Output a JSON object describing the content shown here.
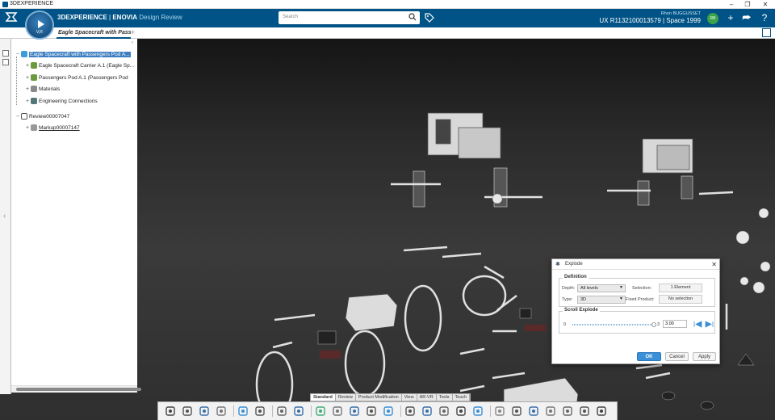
{
  "os": {
    "title": "3DEXPERIENCE",
    "controls": [
      "–",
      "❐",
      "✕"
    ]
  },
  "header": {
    "brand_prefix": "3DEXPERIENCE",
    "brand_app": "ENOVIA",
    "brand_module": "Design Review",
    "search_placeholder": "Search",
    "user_name": "Rhon BUGGUSSET",
    "space": "UX R1132100013579 | Space 1999",
    "avatar_initials": "RB",
    "colors": {
      "header_bg": "#005386",
      "accent": "#3a8fd6",
      "avatar": "#3aa24a"
    }
  },
  "compass": {
    "label": "V,R"
  },
  "tabs": {
    "doc_title": "Eagle Spacecraft with Pass",
    "add": "+"
  },
  "tree": {
    "nodes": [
      {
        "label": "Eagle Spacecraft with Passengers Pod A...",
        "selected": true,
        "icon": "product-icon"
      },
      {
        "label": "Eagle Spacecraft Carrier A.1 (Eagle Sp...",
        "icon": "part-icon"
      },
      {
        "label": "Passengers Pod A.1 (Passengers Pod",
        "icon": "part-icon"
      },
      {
        "label": "Materials",
        "icon": "materials-icon"
      },
      {
        "label": "Engineering Connections",
        "icon": "connections-icon"
      },
      {
        "label": "Review00007047",
        "icon": "review-icon"
      },
      {
        "label": "Markup00007147",
        "icon": "markup-icon"
      }
    ]
  },
  "dialog": {
    "title": "Explode",
    "definition_label": "Definition",
    "depth_label": "Depth:",
    "depth_value": "All levels",
    "type_label": "Type:",
    "type_value": "3D",
    "selection_label": "Selection:",
    "selection_value": "1 Element",
    "fixed_label": "Fixed Product:",
    "fixed_value": "No selection",
    "scroll_label": "Scroll Explode",
    "slider_min": "0",
    "slider_max": "3",
    "slider_value": "3.00",
    "ok": "OK",
    "cancel": "Cancel",
    "apply": "Apply"
  },
  "bottom_tabs": [
    "Standard",
    "Review",
    "Product Modification",
    "View",
    "AR-VR",
    "Tools",
    "Touch"
  ],
  "toolbar_icons": [
    "select-icon",
    "cut-icon",
    "copy-icon",
    "paste-icon",
    "undo-icon",
    "check-icon",
    "capture-icon",
    "annotate-icon",
    "pencil-icon",
    "box-icon",
    "explode-icon",
    "simulate-icon",
    "rotate-icon",
    "tree-icon",
    "compare-icon",
    "section-icon",
    "measure-icon",
    "arrow-icon",
    "sphere-icon",
    "view-2d-icon",
    "grid-icon",
    "material-icon",
    "lighting-icon",
    "layers-icon",
    "render-icon"
  ]
}
